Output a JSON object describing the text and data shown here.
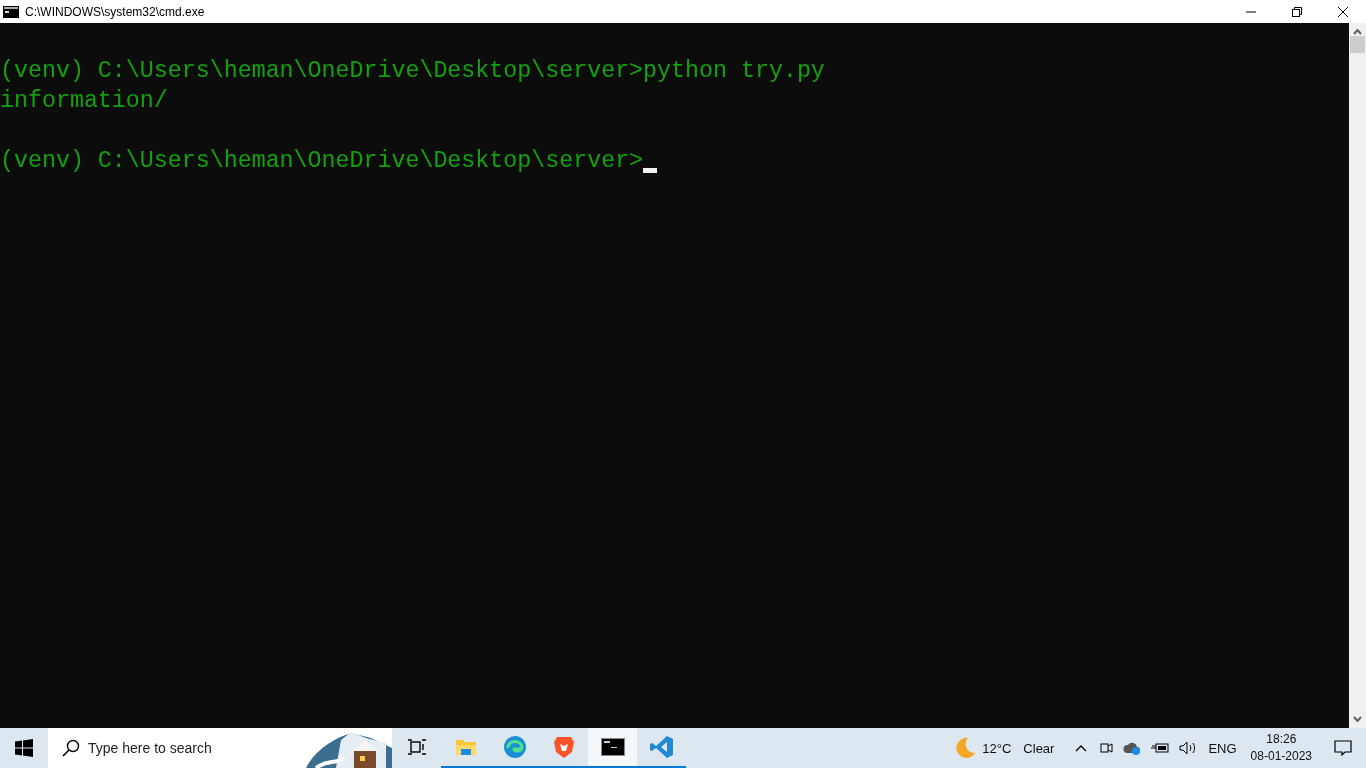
{
  "window": {
    "title": "C:\\WINDOWS\\system32\\cmd.exe"
  },
  "console": {
    "blocks": [
      {
        "lines": [
          "(venv) C:\\Users\\heman\\OneDrive\\Desktop\\server>python try.py",
          "information/"
        ]
      },
      {
        "lines": [
          "(venv) C:\\Users\\heman\\OneDrive\\Desktop\\server>"
        ]
      }
    ],
    "cursor": true
  },
  "taskbar": {
    "search": {
      "placeholder": "Type here to search"
    },
    "apps": [
      {
        "kind": "explorer",
        "running": true,
        "selected": false
      },
      {
        "kind": "edge",
        "running": true,
        "selected": false
      },
      {
        "kind": "brave",
        "running": true,
        "selected": false
      },
      {
        "kind": "terminal",
        "running": true,
        "selected": true
      },
      {
        "kind": "vscode",
        "running": true,
        "selected": false
      }
    ],
    "weather": {
      "temp": "12°C",
      "condition": "Clear"
    },
    "language": "ENG",
    "time": "18:26",
    "date": "08-01-2023"
  }
}
